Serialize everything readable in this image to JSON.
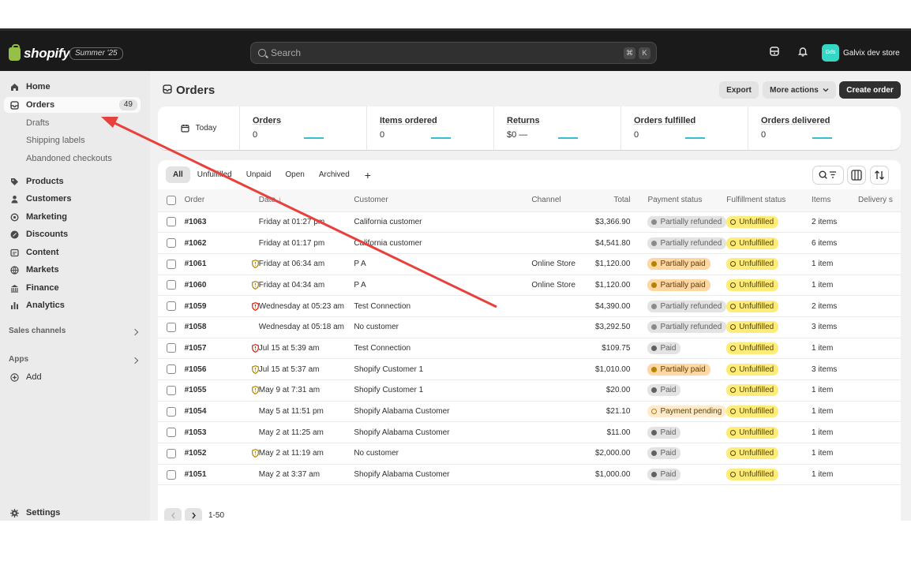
{
  "brand": {
    "logo_text": "shopify",
    "edition": "Summer '25"
  },
  "search": {
    "placeholder": "Search",
    "shortcut_1": "⌘",
    "shortcut_2": "K"
  },
  "store": {
    "avatar": "Gds",
    "name": "Galvix dev store"
  },
  "sidebar": {
    "items": [
      {
        "label": "Home"
      },
      {
        "label": "Orders",
        "count": "49"
      },
      {
        "label": "Products"
      },
      {
        "label": "Customers"
      },
      {
        "label": "Marketing"
      },
      {
        "label": "Discounts"
      },
      {
        "label": "Content"
      },
      {
        "label": "Markets"
      },
      {
        "label": "Finance"
      },
      {
        "label": "Analytics"
      }
    ],
    "sub_items": [
      "Drafts",
      "Shipping labels",
      "Abandoned checkouts"
    ],
    "sales_channels": "Sales channels",
    "apps": "Apps",
    "add": "Add",
    "settings": "Settings"
  },
  "page": {
    "title": "Orders",
    "export": "Export",
    "more_actions": "More actions",
    "create_order": "Create order"
  },
  "metrics": {
    "date": "Today",
    "items": [
      {
        "label": "Orders",
        "value": "0"
      },
      {
        "label": "Items ordered",
        "value": "0"
      },
      {
        "label": "Returns",
        "value": "$0 —"
      },
      {
        "label": "Orders fulfilled",
        "value": "0"
      },
      {
        "label": "Orders delivered",
        "value": "0"
      }
    ]
  },
  "tabs": [
    "All",
    "Unfulfilled",
    "Unpaid",
    "Open",
    "Archived"
  ],
  "table": {
    "headers": {
      "order": "Order",
      "date": "Date ↓",
      "customer": "Customer",
      "channel": "Channel",
      "total": "Total",
      "payment": "Payment status",
      "fulfillment": "Fulfillment status",
      "items": "Items",
      "delivery": "Delivery s"
    },
    "rows": [
      {
        "order": "#1063",
        "risk": "",
        "date": "Friday at 01:27 pm",
        "customer": "California customer",
        "channel": "",
        "total": "$3,366.90",
        "payment": "Partially refunded",
        "pstyle": "gray",
        "fulfillment": "Unfulfilled",
        "items": "2 items"
      },
      {
        "order": "#1062",
        "risk": "",
        "date": "Friday at 01:17 pm",
        "customer": "California customer",
        "channel": "",
        "total": "$4,541.80",
        "payment": "Partially refunded",
        "pstyle": "gray",
        "fulfillment": "Unfulfilled",
        "items": "6 items"
      },
      {
        "order": "#1061",
        "risk": "yellow",
        "date": "Friday at 06:34 am",
        "customer": "P A",
        "channel": "Online Store",
        "total": "$1,120.00",
        "payment": "Partially paid",
        "pstyle": "orange",
        "fulfillment": "Unfulfilled",
        "items": "1 item"
      },
      {
        "order": "#1060",
        "risk": "yellow",
        "date": "Friday at 04:34 am",
        "customer": "P A",
        "channel": "Online Store",
        "total": "$1,120.00",
        "payment": "Partially paid",
        "pstyle": "orange",
        "fulfillment": "Unfulfilled",
        "items": "1 item"
      },
      {
        "order": "#1059",
        "risk": "red",
        "date": "Wednesday at 05:23 am",
        "customer": "Test Connection",
        "channel": "",
        "total": "$4,390.00",
        "payment": "Partially refunded",
        "pstyle": "gray",
        "fulfillment": "Unfulfilled",
        "items": "2 items"
      },
      {
        "order": "#1058",
        "risk": "",
        "date": "Wednesday at 05:18 am",
        "customer": "No customer",
        "channel": "",
        "total": "$3,292.50",
        "payment": "Partially refunded",
        "pstyle": "gray",
        "fulfillment": "Unfulfilled",
        "items": "3 items"
      },
      {
        "order": "#1057",
        "risk": "red",
        "date": "Jul 15 at 5:39 am",
        "customer": "Test Connection",
        "channel": "",
        "total": "$109.75",
        "payment": "Paid",
        "pstyle": "paid",
        "fulfillment": "Unfulfilled",
        "items": "1 item"
      },
      {
        "order": "#1056",
        "risk": "yellow",
        "date": "Jul 15 at 5:37 am",
        "customer": "Shopify Customer 1",
        "channel": "",
        "total": "$1,010.00",
        "payment": "Partially paid",
        "pstyle": "orange",
        "fulfillment": "Unfulfilled",
        "items": "3 items"
      },
      {
        "order": "#1055",
        "risk": "yellow",
        "date": "May 9 at 7:31 am",
        "customer": "Shopify Customer 1",
        "channel": "",
        "total": "$20.00",
        "payment": "Paid",
        "pstyle": "paid",
        "fulfillment": "Unfulfilled",
        "items": "1 item"
      },
      {
        "order": "#1054",
        "risk": "",
        "date": "May 5 at 11:51 pm",
        "customer": "Shopify Alabama Customer",
        "channel": "",
        "total": "$21.10",
        "payment": "Payment pending",
        "pstyle": "pend",
        "fulfillment": "Unfulfilled",
        "items": "1 item"
      },
      {
        "order": "#1053",
        "risk": "",
        "date": "May 2 at 11:25 am",
        "customer": "Shopify Alabama Customer",
        "channel": "",
        "total": "$11.00",
        "payment": "Paid",
        "pstyle": "paid",
        "fulfillment": "Unfulfilled",
        "items": "1 item"
      },
      {
        "order": "#1052",
        "risk": "yellow",
        "date": "May 2 at 11:19 am",
        "customer": "No customer",
        "channel": "",
        "total": "$2,000.00",
        "payment": "Paid",
        "pstyle": "paid",
        "fulfillment": "Unfulfilled",
        "items": "1 item"
      },
      {
        "order": "#1051",
        "risk": "",
        "date": "May 2 at 3:37 am",
        "customer": "Shopify Alabama Customer",
        "channel": "",
        "total": "$1,000.00",
        "payment": "Paid",
        "pstyle": "paid",
        "fulfillment": "Unfulfilled",
        "items": "1 item"
      }
    ]
  },
  "pagination": {
    "range": "1-50"
  },
  "colors": {
    "topbar": "#1a1a1a",
    "sidebar": "#ebebeb",
    "annotation_arrow": "#e8413d"
  }
}
